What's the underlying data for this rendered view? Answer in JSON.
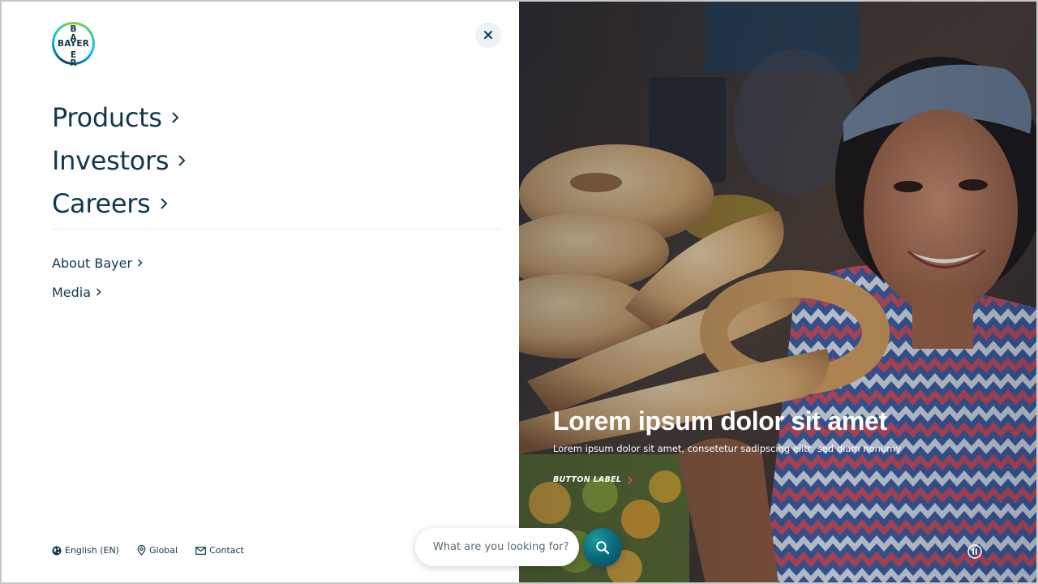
{
  "brand": {
    "logo_horizontal": "BAYER",
    "logo_vertical": [
      "B",
      "A",
      "Y",
      "E",
      "R"
    ],
    "colors": {
      "navy": "#10384f",
      "green": "#89d329",
      "blue": "#00bcff",
      "teal": "#0a6d7d"
    }
  },
  "header": {
    "close_icon": "close-icon"
  },
  "primary_nav": [
    {
      "label": "Products",
      "icon": "chevron-right-icon"
    },
    {
      "label": "Investors",
      "icon": "chevron-right-icon"
    },
    {
      "label": "Careers",
      "icon": "chevron-right-icon"
    }
  ],
  "secondary_nav": [
    {
      "label": "About Bayer",
      "icon": "chevron-right-icon"
    },
    {
      "label": "Media",
      "icon": "chevron-right-icon"
    }
  ],
  "footer": {
    "language": {
      "label": "English (EN)",
      "icon": "globe-icon"
    },
    "region": {
      "label": "Global",
      "icon": "location-pin-icon"
    },
    "contact": {
      "label": "Contact",
      "icon": "mail-icon"
    }
  },
  "hero": {
    "title": "Lorem ipsum dolor sit amet",
    "subtitle": "Lorem ipsum dolor sit amet, consetetur sadipscing elitr, sed diam nonumy",
    "button_label": "BUTTON LABEL",
    "button_icon": "chevron-right-icon",
    "pause_icon": "pause-icon"
  },
  "search": {
    "placeholder": "What are you looking for?",
    "value": "",
    "icon": "search-icon"
  }
}
